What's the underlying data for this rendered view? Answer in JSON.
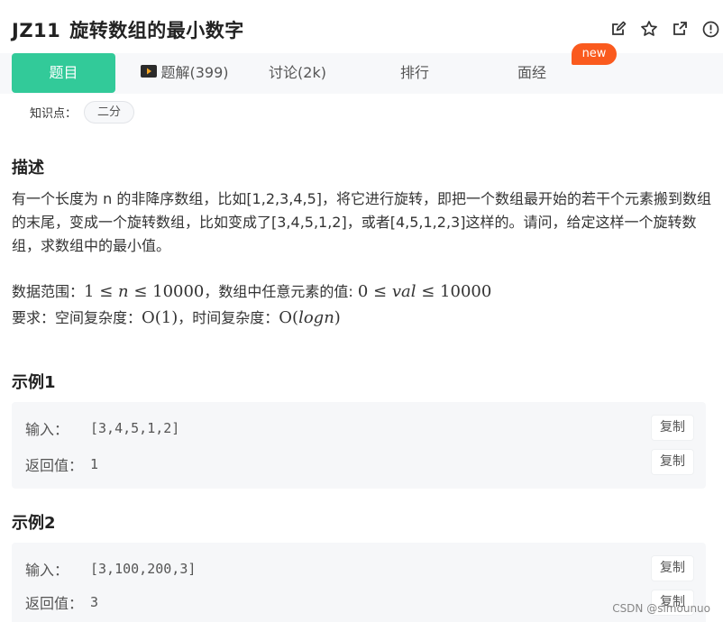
{
  "header": {
    "problem_code": "JZ11",
    "problem_title": "旋转数组的最小数字",
    "icons": [
      "edit-icon",
      "star-icon",
      "external-link-icon",
      "info-icon"
    ]
  },
  "tabs": {
    "problem": "题目",
    "solution": "题解(399)",
    "discuss": "讨论(2k)",
    "rank": "排行",
    "interview": "面经",
    "new_badge": "new"
  },
  "knowledge": {
    "label": "知识点：",
    "tag": "二分"
  },
  "description": {
    "heading": "描述",
    "text": "有一个长度为 n 的非降序数组，比如[1,2,3,4,5]，将它进行旋转，即把一个数组最开始的若干个元素搬到数组的末尾，变成一个旋转数组，比如变成了[3,4,5,1,2]，或者[4,5,1,2,3]这样的。请问，给定这样一个旋转数组，求数组中的最小值。",
    "range_label": "数据范围：",
    "range_math_1": "1 ≤ ",
    "range_var_n": "n",
    "range_math_2": " ≤ 10000",
    "range_mid": "，数组中任意元素的值: ",
    "range_math_3": "0 ≤ ",
    "range_var_val": "val",
    "range_math_4": " ≤ 10000",
    "req_label": "要求：空间复杂度：",
    "space": "O(1)",
    "req_mid": "，时间复杂度：",
    "time_1": "O(",
    "time_var": "logn",
    "time_2": ")"
  },
  "examples": [
    {
      "heading": "示例1",
      "input_label": "输入：",
      "input_value": "[3,4,5,1,2]",
      "output_label": "返回值：",
      "output_value": "1",
      "copy_label": "复制"
    },
    {
      "heading": "示例2",
      "input_label": "输入：",
      "input_value": "[3,100,200,3]",
      "output_label": "返回值：",
      "output_value": "3",
      "copy_label": "复制"
    }
  ],
  "watermark": "CSDN @simounuo",
  "colors": {
    "accent": "#32ca99",
    "badge": "#fa5a1e",
    "panel": "#f6f7f9"
  }
}
